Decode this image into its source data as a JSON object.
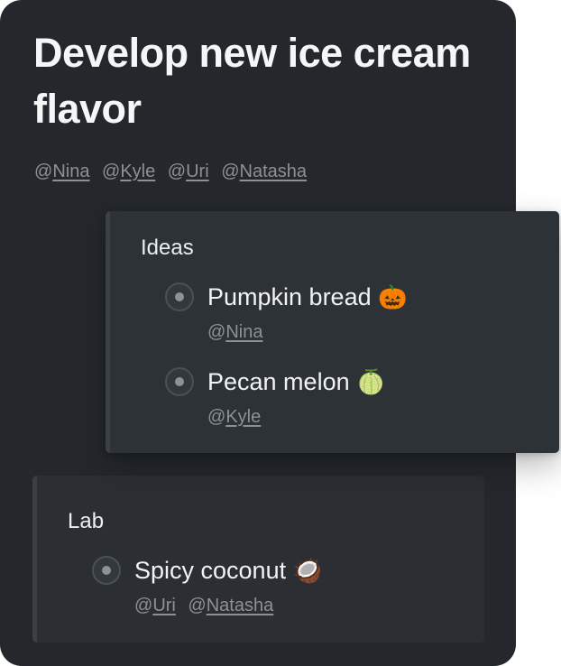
{
  "card": {
    "title": "Develop new ice cream flavor",
    "mentions": [
      {
        "at": "@",
        "name": "Nina"
      },
      {
        "at": "@",
        "name": "Kyle"
      },
      {
        "at": "@",
        "name": "Uri"
      },
      {
        "at": "@",
        "name": "Natasha"
      }
    ]
  },
  "ideas": {
    "title": "Ideas",
    "items": [
      {
        "label": "Pumpkin bread",
        "emoji": "🎃",
        "emoji_icon": "jack-o-lantern-icon",
        "mentions": [
          {
            "at": "@",
            "name": "Nina"
          }
        ]
      },
      {
        "label": "Pecan melon",
        "emoji": "🍈",
        "emoji_icon": "melon-icon",
        "mentions": [
          {
            "at": "@",
            "name": "Kyle"
          }
        ]
      }
    ]
  },
  "lab": {
    "title": "Lab",
    "items": [
      {
        "label": "Spicy coconut",
        "emoji": "🥥",
        "emoji_icon": "coconut-icon",
        "mentions": [
          {
            "at": "@",
            "name": "Uri"
          },
          {
            "at": "@",
            "name": "Natasha"
          }
        ]
      }
    ]
  },
  "colors": {
    "card_background": "#24282c",
    "panel_background": "#2d3236",
    "title_text": "#f5f6f7",
    "mention_text": "#8d9196"
  }
}
